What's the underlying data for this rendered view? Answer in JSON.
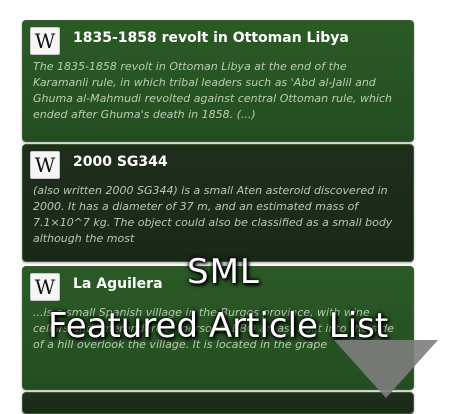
{
  "articles": [
    {
      "title": "1835-1858 revolt in Ottoman Libya",
      "summary": "The 1835-1858 revolt in Ottoman Libya at the end of the Karamanli rule, in which tribal leaders such as 'Abd al-Jalil and Ghuma al-Mahmudi revolted against central Ottoman rule, which ended after Ghuma's death in 1858. (...)",
      "icon": "wikipedia-icon"
    },
    {
      "title": "2000 SG344",
      "summary": "(also written 2000 SG344) is a small Aten asteroid discovered in 2000. It has a diameter of 37 m, and an estimated mass of 7.1×10^7 kg. The object could also be classified as a small body although the most",
      "icon": "wikipedia-icon"
    },
    {
      "title": "La Aguilera",
      "summary": "...is a small Spanish village in the Burgos province, with wine cellars and \"merenderos\" (personal BBQ areas) built into the side of a hill overlook the village. It is located in the grape",
      "icon": "wikipedia-icon"
    }
  ],
  "overlay": {
    "line1": "SML",
    "line2": "Featured Article List"
  },
  "colors": {
    "card_green": "#2b5a26",
    "card_dark": "#1f2f1c",
    "text_white": "#ffffff",
    "arrow_gray": "#7d7d7d"
  }
}
